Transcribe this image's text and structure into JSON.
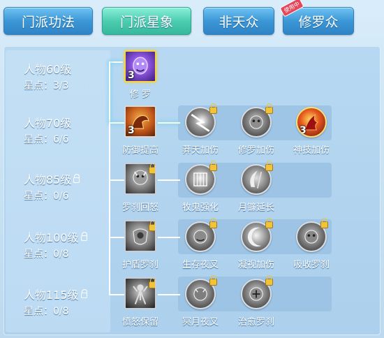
{
  "tabs": [
    {
      "label": "门派功法",
      "active": false
    },
    {
      "label": "门派星象",
      "active": true
    },
    {
      "label": "非天众",
      "active": false
    },
    {
      "label": "修罗众",
      "active": false,
      "badge": "使用中"
    }
  ],
  "levels": [
    {
      "title": "人物60级",
      "points": "星点：3/3",
      "locked": false
    },
    {
      "title": "人物70级",
      "points": "星点：6/6",
      "locked": false
    },
    {
      "title": "人物85级",
      "points": "星点：0/6",
      "locked": true
    },
    {
      "title": "人物100级",
      "points": "星点：0/8",
      "locked": true
    },
    {
      "title": "人物115级",
      "points": "星点：0/8",
      "locked": true
    }
  ],
  "nodes": {
    "xiuluo": {
      "label": "修 罗",
      "count": "3",
      "icon": "purple-demon-icon"
    },
    "fangyu": {
      "label": "防御提高",
      "count": "3",
      "icon": "strong-arm-icon"
    },
    "mangtian": {
      "label": "莽天加伤",
      "icon": "lightning-strike-icon",
      "locked": true
    },
    "xiuluojs": {
      "label": "修罗加伤",
      "icon": "demon-face-icon",
      "locked": true
    },
    "shenji": {
      "label": "神技加伤",
      "count": "3",
      "icon": "crimson-flame-icon"
    },
    "luocha": {
      "label": "罗刹回怒",
      "icon": "rakshasa-icon",
      "locked": true
    },
    "mugui": {
      "label": "牧鬼强化",
      "icon": "ghost-cage-icon",
      "locked": true
    },
    "yuelian": {
      "label": "月镰延长",
      "icon": "moon-sickle-icon",
      "locked": true
    },
    "hudun": {
      "label": "护盾罗刹",
      "icon": "shield-rakshasa-icon",
      "locked": true
    },
    "shengcun": {
      "label": "生存夜叉",
      "icon": "yaksha-icon",
      "locked": true
    },
    "ningshi": {
      "label": "凝视加伤",
      "icon": "crescent-icon",
      "locked": true
    },
    "xishou": {
      "label": "吸收罗刹",
      "icon": "absorb-demon-icon",
      "locked": true
    },
    "fennu": {
      "label": "愤怒保留",
      "icon": "wrath-figure-icon",
      "locked": true
    },
    "mingyue": {
      "label": "冥月夜叉",
      "icon": "dark-yaksha-icon",
      "locked": true
    },
    "zhiyu": {
      "label": "治愈罗刹",
      "icon": "heal-demon-icon",
      "locked": true
    }
  },
  "colors": {
    "tab_active": "#4dcdb0",
    "tab_normal": "#3c97d6",
    "highlight_gold": "#f6d640",
    "lock_gold": "#f0c33a",
    "badge_red": "#e5465a"
  }
}
